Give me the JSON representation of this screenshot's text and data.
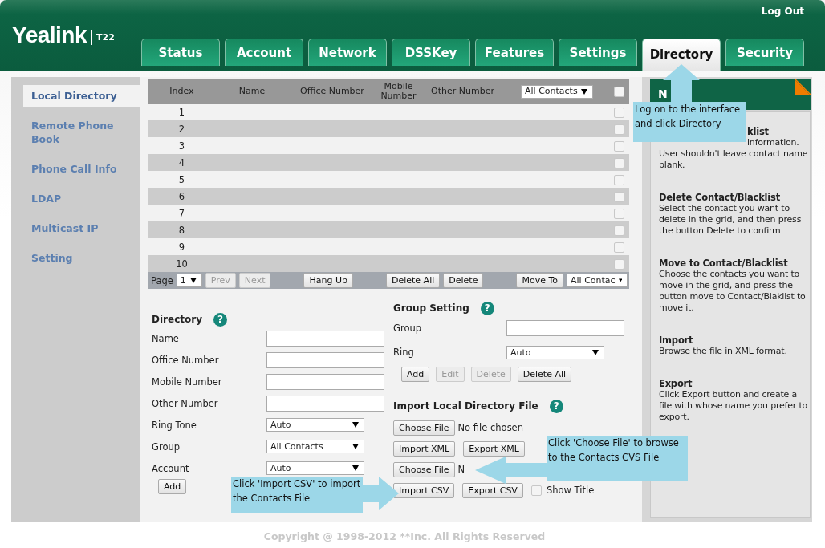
{
  "header": {
    "logo": "Yealink",
    "model": "T22",
    "logout": "Log Out"
  },
  "tabs": [
    {
      "label": "Status",
      "selected": false
    },
    {
      "label": "Account",
      "selected": false
    },
    {
      "label": "Network",
      "selected": false
    },
    {
      "label": "DSSKey",
      "selected": false
    },
    {
      "label": "Features",
      "selected": false
    },
    {
      "label": "Settings",
      "selected": false
    },
    {
      "label": "Directory",
      "selected": true
    },
    {
      "label": "Security",
      "selected": false
    }
  ],
  "sidebar": [
    {
      "label": "Local Directory",
      "selected": true
    },
    {
      "label": "Remote Phone Book",
      "selected": false
    },
    {
      "label": "Phone Call Info",
      "selected": false
    },
    {
      "label": "LDAP",
      "selected": false
    },
    {
      "label": "Multicast IP",
      "selected": false
    },
    {
      "label": "Setting",
      "selected": false
    }
  ],
  "table": {
    "columns": [
      "Index",
      "Name",
      "Office Number",
      "Mobile Number",
      "Other Number"
    ],
    "filter": "All Contacts",
    "select_all_checked": false,
    "rows": [
      {
        "index": "1",
        "checked": false
      },
      {
        "index": "2",
        "checked": false
      },
      {
        "index": "3",
        "checked": false
      },
      {
        "index": "4",
        "checked": false
      },
      {
        "index": "5",
        "checked": false
      },
      {
        "index": "6",
        "checked": false
      },
      {
        "index": "7",
        "checked": false
      },
      {
        "index": "8",
        "checked": false
      },
      {
        "index": "9",
        "checked": false
      },
      {
        "index": "10",
        "checked": false
      }
    ]
  },
  "pager": {
    "page_label": "Page",
    "page": "1",
    "move_select": "All Contac",
    "groups": [
      {
        "buttons": [
          {
            "label": "Prev",
            "disabled": true
          },
          {
            "label": "Next",
            "disabled": true
          }
        ]
      },
      {
        "buttons": [
          {
            "label": "Hang Up",
            "disabled": false
          }
        ]
      },
      {
        "buttons": [
          {
            "label": "Delete All",
            "disabled": false
          },
          {
            "label": "Delete",
            "disabled": false
          }
        ]
      },
      {
        "buttons": [
          {
            "label": "Move To",
            "disabled": false
          }
        ]
      }
    ]
  },
  "directory": {
    "title": "Directory",
    "help": "?",
    "fields": [
      {
        "label": "Name",
        "kind": "text"
      },
      {
        "label": "Office Number",
        "kind": "text"
      },
      {
        "label": "Mobile Number",
        "kind": "text"
      },
      {
        "label": "Other Number",
        "kind": "text"
      },
      {
        "label": "Ring Tone",
        "kind": "select",
        "value": "Auto"
      },
      {
        "label": "Group",
        "kind": "select",
        "value": "All Contacts"
      },
      {
        "label": "Account",
        "kind": "select",
        "value": "Auto"
      }
    ],
    "button": "Add"
  },
  "group_setting": {
    "title": "Group Setting",
    "help": "?",
    "fields": [
      {
        "label": "Group",
        "kind": "text"
      },
      {
        "label": "Ring",
        "kind": "select",
        "value": "Auto"
      }
    ],
    "buttons": [
      {
        "label": "Add",
        "disabled": false
      },
      {
        "label": "Edit",
        "disabled": true
      },
      {
        "label": "Delete",
        "disabled": true
      },
      {
        "label": "Delete All",
        "disabled": false
      }
    ]
  },
  "import": {
    "title": "Import Local Directory File",
    "help": "?",
    "rows": [
      {
        "buttons": [
          "Choose File"
        ],
        "status": "No file chosen"
      },
      {
        "buttons": [
          "Import XML",
          "Export XML"
        ]
      },
      {
        "buttons": [
          "Choose File"
        ],
        "status": "N"
      },
      {
        "buttons": [
          "Import CSV",
          "Export CSV"
        ],
        "checkbox": {
          "label": "Show Title",
          "checked": false
        }
      }
    ]
  },
  "notes": {
    "title": "N",
    "items": [
      {
        "kind": "covered",
        "title": "klist",
        "tail": "information.",
        "body": "User shouldn't leave contact name blank."
      },
      {
        "kind": "full",
        "title": "Delete Contact/Blacklist",
        "body": "Select the contact you want to delete in the grid, and then press the button Delete to confirm."
      },
      {
        "kind": "full",
        "title": "Move to Contact/Blacklist",
        "body": "Choose the contacts you want to move in the grid, and press the button move to Contact/Blaklist to move it."
      },
      {
        "kind": "full",
        "title": "Import",
        "body": "Browse the file in XML format."
      },
      {
        "kind": "full",
        "title": "Export",
        "body": "Click Export button and create a file with whose name you prefer to export."
      }
    ]
  },
  "callouts": [
    {
      "kind": "up",
      "text": "Log on to the interface and click Directory"
    },
    {
      "kind": "left",
      "text": "Click 'Choose File' to browse to the Contacts CVS File"
    },
    {
      "kind": "right",
      "text": "Click 'Import CSV' to import the Contacts File"
    }
  ],
  "footer": "Copyright @ 1998-2012 **Inc. All Rights Reserved"
}
